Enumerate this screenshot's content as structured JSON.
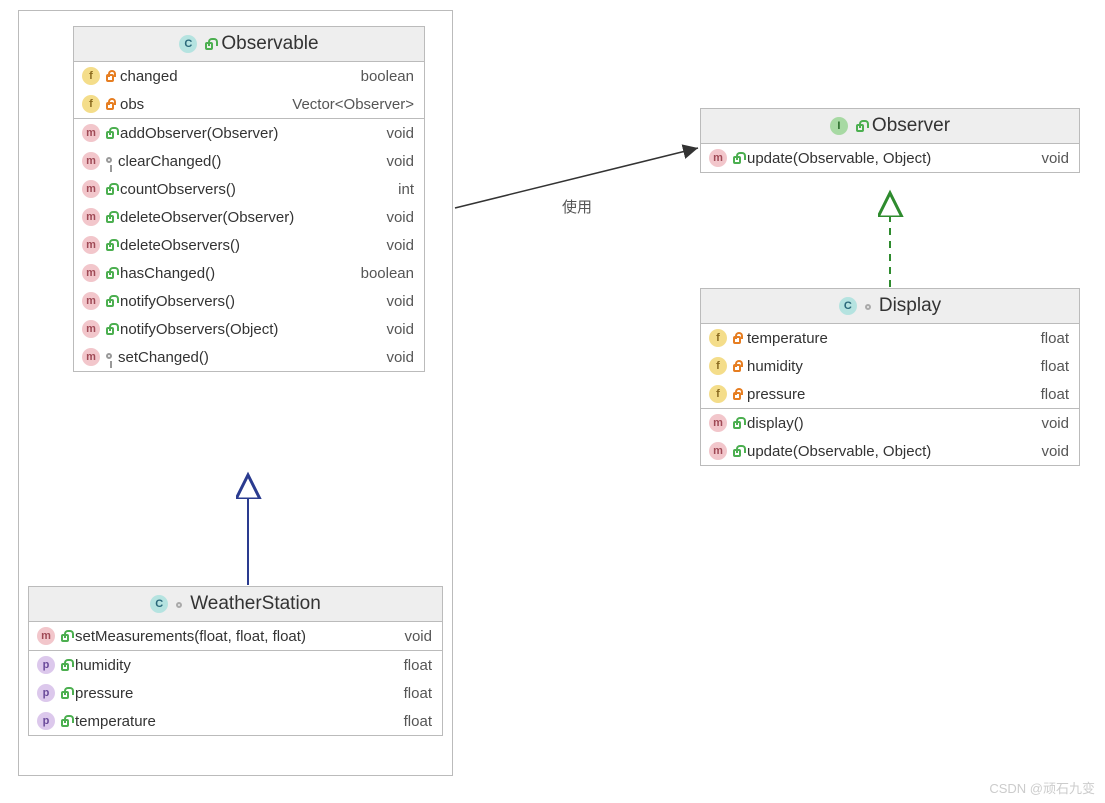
{
  "observable": {
    "title": "Observable",
    "stereotype": "c",
    "fields": [
      {
        "kind": "f",
        "vis": "private",
        "name": "changed",
        "type": "boolean"
      },
      {
        "kind": "f",
        "vis": "private",
        "name": "obs",
        "type": "Vector<Observer>"
      }
    ],
    "methods": [
      {
        "kind": "m",
        "vis": "public",
        "name": "addObserver(Observer)",
        "type": "void"
      },
      {
        "kind": "m",
        "vis": "protected",
        "name": "clearChanged()",
        "type": "void"
      },
      {
        "kind": "m",
        "vis": "public",
        "name": "countObservers()",
        "type": "int"
      },
      {
        "kind": "m",
        "vis": "public",
        "name": "deleteObserver(Observer)",
        "type": "void"
      },
      {
        "kind": "m",
        "vis": "public",
        "name": "deleteObservers()",
        "type": "void"
      },
      {
        "kind": "m",
        "vis": "public",
        "name": "hasChanged()",
        "type": "boolean"
      },
      {
        "kind": "m",
        "vis": "public",
        "name": "notifyObservers()",
        "type": "void"
      },
      {
        "kind": "m",
        "vis": "public",
        "name": "notifyObservers(Object)",
        "type": "void"
      },
      {
        "kind": "m",
        "vis": "protected",
        "name": "setChanged()",
        "type": "void"
      }
    ]
  },
  "weatherStation": {
    "title": "WeatherStation",
    "stereotype": "c",
    "methods": [
      {
        "kind": "m",
        "vis": "public",
        "name": "setMeasurements(float, float, float)",
        "type": "void"
      }
    ],
    "properties": [
      {
        "kind": "p",
        "vis": "public",
        "name": "humidity",
        "type": "float"
      },
      {
        "kind": "p",
        "vis": "public",
        "name": "pressure",
        "type": "float"
      },
      {
        "kind": "p",
        "vis": "public",
        "name": "temperature",
        "type": "float"
      }
    ]
  },
  "observer": {
    "title": "Observer",
    "stereotype": "i",
    "methods": [
      {
        "kind": "m",
        "vis": "public",
        "name": "update(Observable, Object)",
        "type": "void"
      }
    ]
  },
  "display": {
    "title": "Display",
    "stereotype": "c",
    "fields": [
      {
        "kind": "f",
        "vis": "private",
        "name": "temperature",
        "type": "float"
      },
      {
        "kind": "f",
        "vis": "private",
        "name": "humidity",
        "type": "float"
      },
      {
        "kind": "f",
        "vis": "private",
        "name": "pressure",
        "type": "float"
      }
    ],
    "methods": [
      {
        "kind": "m",
        "vis": "public",
        "name": "display()",
        "type": "void"
      },
      {
        "kind": "m",
        "vis": "public",
        "name": "update(Observable, Object)",
        "type": "void"
      }
    ]
  },
  "relations": {
    "usesLabel": "使用"
  },
  "watermark": "CSDN @顽石九变"
}
